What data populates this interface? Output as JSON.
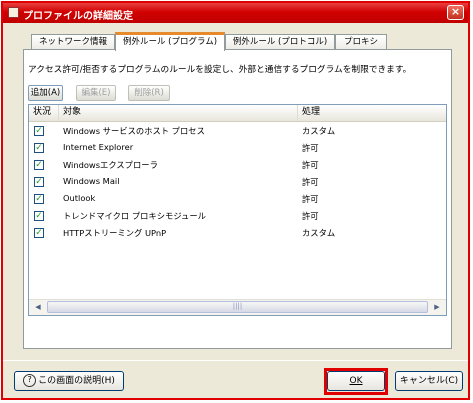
{
  "window": {
    "title": "プロファイルの詳細設定",
    "close_label": "×"
  },
  "tabs": [
    {
      "label": "ネットワーク情報"
    },
    {
      "label": "例外ルール (プログラム)"
    },
    {
      "label": "例外ルール (プロトコル)"
    },
    {
      "label": "プロキシ"
    }
  ],
  "panel": {
    "description": "アクセス許可/拒否するプログラムのルールを設定し、外部と通信するプログラムを制限できます。",
    "toolbar": {
      "add": "追加(A)",
      "edit": "編集(E)",
      "delete": "削除(R)"
    },
    "columns": {
      "status": "状況",
      "target": "対象",
      "action": "処理"
    },
    "rows": [
      {
        "name": "Windows サービスのホスト プロセス",
        "action": "カスタム",
        "checked": "✓"
      },
      {
        "name": "Internet Explorer",
        "action": "許可",
        "checked": "✓"
      },
      {
        "name": "Windowsエクスプローラ",
        "action": "許可",
        "checked": "✓"
      },
      {
        "name": "Windows Mail",
        "action": "許可",
        "checked": "✓"
      },
      {
        "name": "Outlook",
        "action": "許可",
        "checked": "✓"
      },
      {
        "name": "トレンドマイクロ プロキシモジュール",
        "action": "許可",
        "checked": "✓"
      },
      {
        "name": "HTTPストリーミング UPnP",
        "action": "カスタム",
        "checked": "✓"
      }
    ],
    "scroll": {
      "left": "◀",
      "right": "▶",
      "grip": "||||"
    }
  },
  "footer": {
    "help": "この画面の説明(H)",
    "help_icon": "?",
    "ok": "OK",
    "cancel": "キャンセル(C)"
  },
  "colors": {
    "title_bar": "#d00000",
    "highlight": "#e00000",
    "tab_accent": "#e68b2c",
    "check": "#21a121"
  }
}
